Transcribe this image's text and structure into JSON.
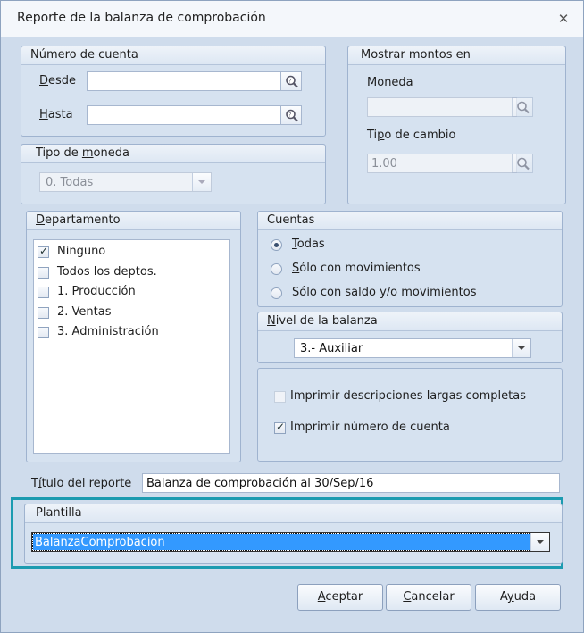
{
  "window": {
    "title": "Reporte de la balanza de comprobación"
  },
  "numero_cuenta": {
    "title": "Número de cuenta",
    "desde_label": "Desde",
    "desde_value": "",
    "hasta_label": "Hasta",
    "hasta_value": ""
  },
  "mostrar_montos": {
    "title": "Mostrar montos en",
    "moneda_label": "Moneda",
    "moneda_value": "",
    "tipo_cambio_label": "Tipo de cambio",
    "tipo_cambio_value": "1.00"
  },
  "tipo_moneda": {
    "title": "Tipo de moneda",
    "selected": "0. Todas"
  },
  "departamento": {
    "title": "Departamento",
    "items": [
      {
        "label": "Ninguno",
        "checked": true
      },
      {
        "label": "Todos los deptos.",
        "checked": false
      },
      {
        "label": "1. Producción",
        "checked": false
      },
      {
        "label": "2. Ventas",
        "checked": false
      },
      {
        "label": "3. Administración",
        "checked": false
      }
    ]
  },
  "cuentas": {
    "title": "Cuentas",
    "options": [
      {
        "label": "Todas",
        "selected": true
      },
      {
        "label": "Sólo con movimientos",
        "selected": false
      },
      {
        "label": "Sólo con saldo y/o movimientos",
        "selected": false
      }
    ]
  },
  "nivel_balanza": {
    "title": "Nivel de la balanza",
    "selected": "3.- Auxiliar"
  },
  "opciones": {
    "imprimir_descripciones": {
      "label": "Imprimir descripciones largas completas",
      "checked": false
    },
    "imprimir_numero": {
      "label": "Imprimir número de cuenta",
      "checked": true
    }
  },
  "titulo_reporte": {
    "label": "Título del reporte",
    "value": "Balanza de comprobación al 30/Sep/16"
  },
  "plantilla": {
    "title": "Plantilla",
    "selected": "BalanzaComprobacion"
  },
  "buttons": {
    "aceptar": "Aceptar",
    "cancelar": "Cancelar",
    "ayuda": "Ayuda"
  },
  "colors": {
    "highlight": "#1c9bb0",
    "selection": "#3399ff",
    "panel": "#cfdcec"
  },
  "icons": {
    "search": "magnifier-icon",
    "close": "close-icon",
    "dropdown": "chevron-down-icon"
  }
}
